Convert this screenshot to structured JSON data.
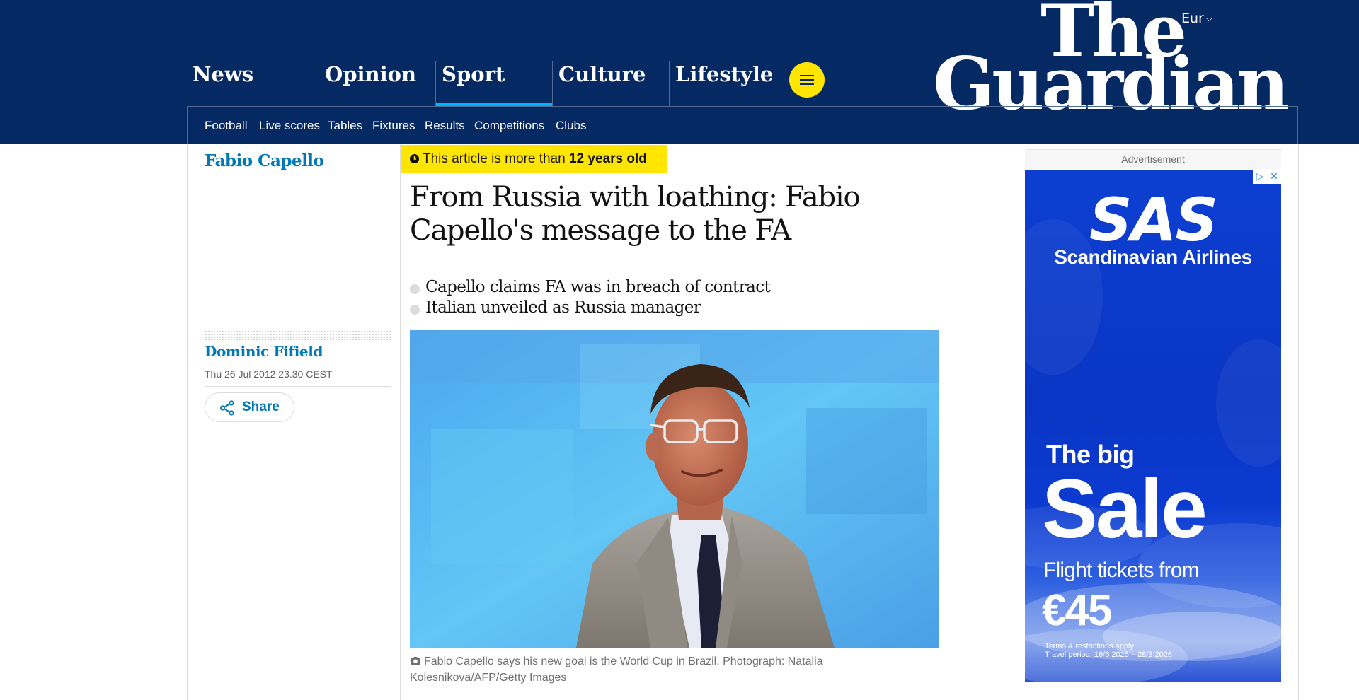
{
  "header": {
    "edition": "Eur",
    "logo_line1": "The",
    "logo_line2": "Guardian",
    "pillars": [
      {
        "label": "News",
        "active": false
      },
      {
        "label": "Opinion",
        "active": false
      },
      {
        "label": "Sport",
        "active": true
      },
      {
        "label": "Culture",
        "active": false
      },
      {
        "label": "Lifestyle",
        "active": false
      }
    ],
    "subnav": [
      "Football",
      "Live scores",
      "Tables",
      "Fixtures",
      "Results",
      "Competitions",
      "Clubs"
    ],
    "colors": {
      "brand": "#052962",
      "accent_sport": "#00b2ff",
      "menu_button": "#ffe500"
    }
  },
  "article": {
    "series": "Fabio Capello",
    "age_notice": {
      "prefix": "This article is more than",
      "emphasis": "12 years old"
    },
    "headline": "From Russia with loathing: Fabio Capello's message to the FA",
    "standfirst": [
      "Capello claims FA was in breach of contract",
      "Italian unveiled as Russia manager"
    ],
    "author": "Dominic Fifield",
    "date": "Thu 26 Jul 2012 23.30 CEST",
    "share_label": "Share",
    "caption": "Fabio Capello says his new goal is the World Cup in Brazil. Photograph: Natalia Kolesnikova/AFP/Getty Images",
    "link_color": "#0077b6"
  },
  "advert": {
    "label": "Advertisement",
    "brand": "SAS",
    "airline": "Scandinavian Airlines",
    "headline_small": "The big",
    "headline_large": "Sale",
    "offer_line": "Flight tickets from",
    "price": "€45",
    "terms_line1": "Terms & restrictions apply",
    "terms_line2": "Travel period: 16/6 2025 – 28/3 2026",
    "icons": [
      "adchoices-icon",
      "close-icon"
    ]
  }
}
